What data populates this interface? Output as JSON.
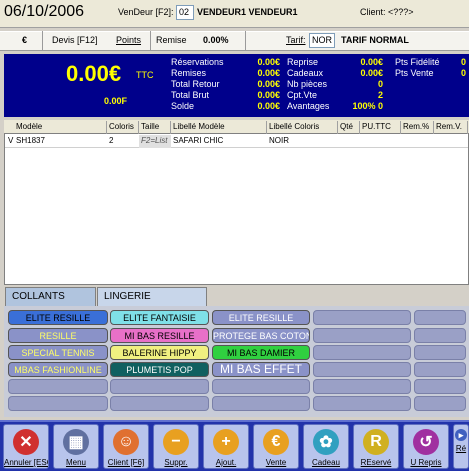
{
  "top": {
    "date": "06/10/2006",
    "vendeur_label": "VenDeur [F2]:",
    "vendeur_code": "02",
    "vendeur_name": "VENDEUR1 VENDEUR1",
    "client_label": "Client: <???>"
  },
  "bar2": {
    "currency": "€",
    "devis": "Devis [F12]",
    "points": "Points",
    "remise_label": "Remise",
    "remise_value": "0.00%",
    "tarif_label": "Tarif:",
    "tarif_code": "NOR",
    "tarif_name": "TARIF NORMAL"
  },
  "totals": {
    "big": "0.00€",
    "ttc": "TTC",
    "f": "0.00F",
    "left_labels": [
      "Réservations",
      "Remises",
      "Total Retour",
      "Total Brut",
      "Solde"
    ],
    "left_values": [
      "0.00€",
      "0.00€",
      "0.00€",
      "0.00€",
      "0.00€"
    ],
    "mid_labels": [
      "Reprise",
      "Cadeaux",
      "Nb pièces",
      "Cpt.Vte",
      "Avantages"
    ],
    "mid_values": [
      "0.00€",
      "0.00€",
      "0",
      "2",
      "100% 0"
    ],
    "right_labels": [
      "Pts Fidélité",
      "Pts Vente"
    ],
    "right_values": [
      "0",
      "0"
    ]
  },
  "table": {
    "headers": [
      "Modèle",
      "Coloris",
      "Taille",
      "Libellé Modèle",
      "Libellé Coloris",
      "Qté",
      "PU.TTC",
      "Rem.%",
      "Rem.V."
    ],
    "row": {
      "marker": "V",
      "modele": "SH1837",
      "coloris": "2",
      "taille": "F2=List",
      "lib_modele": "SAFARI CHIC",
      "lib_coloris": "NOIR"
    }
  },
  "tabs": [
    "COLLANTS",
    "LINGERIE"
  ],
  "grid": {
    "buttons": [
      {
        "label": "ELITE RESILLE",
        "bg": "#3a6fd8",
        "fg": "#000000"
      },
      {
        "label": "ELITE FANTAISIE",
        "bg": "#7fe0e8",
        "fg": "#000000"
      },
      {
        "label": "ELITE RESILLE",
        "bg": "#8a92c8",
        "fg": "#ffffff"
      },
      {
        "label": "RESILLE",
        "bg": "#8a92c8",
        "fg": "#ffff66"
      },
      {
        "label": "MI BAS RESILLE",
        "bg": "#e870c8",
        "fg": "#000000"
      },
      {
        "label": "PROTEGE BAS COTON",
        "bg": "#8a92c8",
        "fg": "#ffffff"
      },
      {
        "label": "SPECIAL TENNIS",
        "bg": "#8a92c8",
        "fg": "#ffff66"
      },
      {
        "label": "BALERINE HIPPY",
        "bg": "#f0f080",
        "fg": "#000000"
      },
      {
        "label": "MI BAS DAMIER",
        "bg": "#30d040",
        "fg": "#000000"
      },
      {
        "label": "MBAS FASHIONLINE",
        "bg": "#8a92c8",
        "fg": "#ffff66"
      },
      {
        "label": "PLUMETIS POP",
        "bg": "#106060",
        "fg": "#ffffff"
      },
      {
        "label": "MI BAS EFFET",
        "bg": "#8a92c8",
        "fg": "#ffffff"
      }
    ]
  },
  "toolbar": {
    "buttons": [
      {
        "label": "Annuler [ESC]",
        "icon": "cancel-icon",
        "glyph": "✕",
        "color": "#d03030"
      },
      {
        "label": "Menu",
        "icon": "menu-icon",
        "glyph": "▦",
        "color": "#6070a0"
      },
      {
        "label": "Client [F6]",
        "icon": "client-icon",
        "glyph": "☺",
        "color": "#e07030"
      },
      {
        "label": "Suppr.",
        "icon": "delete-icon",
        "glyph": "−",
        "color": "#e8a020"
      },
      {
        "label": "Ajout.",
        "icon": "add-icon",
        "glyph": "+",
        "color": "#e8a020"
      },
      {
        "label": "Vente",
        "icon": "sale-icon",
        "glyph": "€",
        "color": "#e8a020"
      },
      {
        "label": "Cadeau",
        "icon": "gift-icon",
        "glyph": "✿",
        "color": "#30a0c0"
      },
      {
        "label": "REservé",
        "icon": "reserved-icon",
        "glyph": "R",
        "color": "#d0b020"
      },
      {
        "label": "U Repris",
        "icon": "return-icon",
        "glyph": "↺",
        "color": "#a030a0"
      },
      {
        "label": "Ré",
        "icon": "more-icon",
        "glyph": "▸",
        "color": "#4060c0"
      }
    ]
  }
}
